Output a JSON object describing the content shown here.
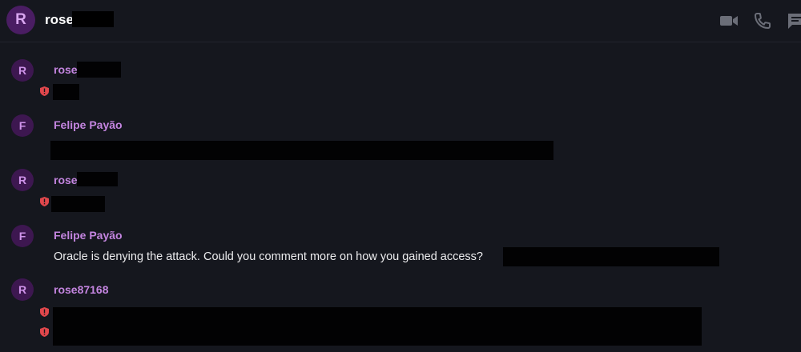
{
  "header": {
    "avatar_initial": "R",
    "contact_name": "rose",
    "icons": [
      "video-camera-icon",
      "phone-icon",
      "chat-icon"
    ]
  },
  "messages": [
    {
      "avatar_initial": "R",
      "sender": "rose",
      "text": ""
    },
    {
      "avatar_initial": "F",
      "sender": "Felipe Payão",
      "text": ""
    },
    {
      "avatar_initial": "R",
      "sender": "rose",
      "text": ""
    },
    {
      "avatar_initial": "F",
      "sender": "Felipe Payão",
      "text": "Oracle is denying the attack. Could you comment more on how you gained access?"
    },
    {
      "avatar_initial": "R",
      "sender": "rose87168",
      "text": ""
    }
  ],
  "colors": {
    "background": "#15171e",
    "sender_name": "#c485e0",
    "avatar_bg": "#3d1750",
    "shield_red": "#e0474c"
  }
}
